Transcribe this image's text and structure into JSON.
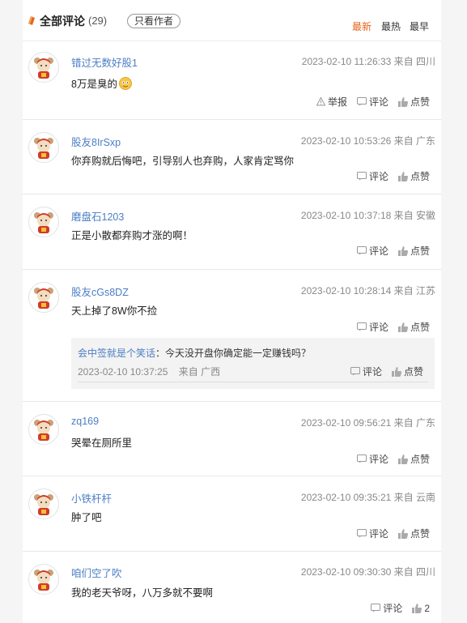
{
  "header": {
    "title": "全部评论",
    "count": "(29)",
    "only_author": "只看作者",
    "sort_newest": "最新",
    "sort_hot": "最热",
    "sort_oldest": "最早"
  },
  "labels": {
    "report": "举报",
    "comment": "评论",
    "like": "点赞"
  },
  "comments": [
    {
      "user": "错过无数好股1",
      "meta": "2023-02-10 11:26:33 来自 四川",
      "text": "8万是臭的",
      "like": "点赞"
    },
    {
      "user": "股友8IrSxp",
      "meta": "2023-02-10 10:53:26 来自 广东",
      "text": "你弃购就后悔吧，引导别人也弃购，人家肯定骂你",
      "like": "点赞"
    },
    {
      "user": "磨盘石1203",
      "meta": "2023-02-10 10:37:18 来自 安徽",
      "text": "正是小散都弃购才涨的啊！",
      "like": "点赞"
    },
    {
      "user": "股友cGs8DZ",
      "meta": "2023-02-10 10:28:14 来自 江苏",
      "text": "天上掉了8W你不捡",
      "like": "点赞",
      "reply": {
        "user": "会中签就是个笑话",
        "text": "：今天没开盘你确定能一定赚钱吗？",
        "meta": "2023-02-10 10:37:25    来自 广西"
      }
    },
    {
      "user": "zq169",
      "meta": "2023-02-10 09:56:21 来自 广东",
      "text": "哭晕在厕所里",
      "like": "点赞"
    },
    {
      "user": "小铁杆杆",
      "meta": "2023-02-10 09:35:21 来自 云南",
      "text": "肿了吧",
      "like": "点赞"
    },
    {
      "user": "咱们空了吹",
      "meta": "2023-02-10 09:30:30 来自 四川",
      "text": "我的老天爷呀，八万多就不要啊",
      "like": "2"
    }
  ],
  "colors": {
    "accent": "#e6631c",
    "link": "#4a7ec4"
  }
}
